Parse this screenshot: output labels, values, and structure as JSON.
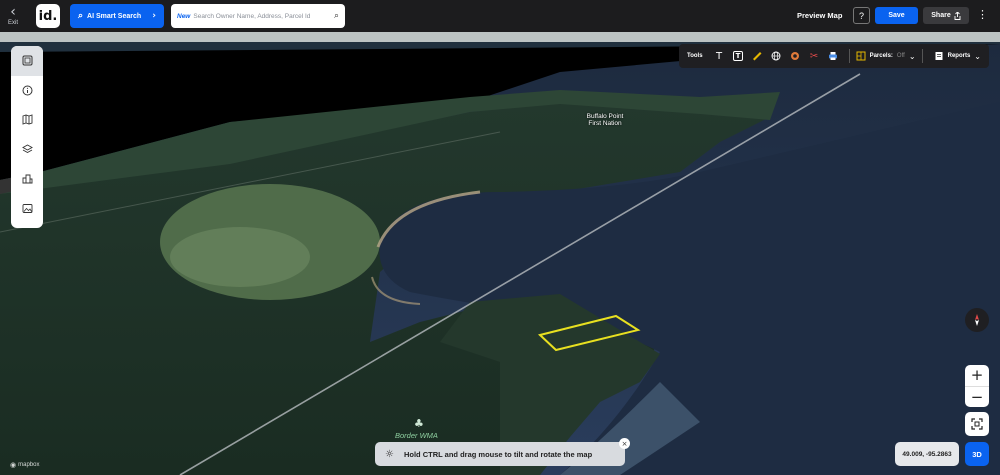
{
  "header": {
    "exit_label": "Exit",
    "logo_text": "id.",
    "ai_button_label": "AI Smart Search",
    "search_new_badge": "New",
    "search_placeholder": "Search Owner Name, Address, Parcel Id",
    "preview_label": "Preview Map",
    "help_label": "?",
    "save_label": "Save",
    "share_label": "Share"
  },
  "left_toolbar": {
    "items": [
      "panel-icon",
      "info-icon",
      "map-icon",
      "layers-icon",
      "buildings-icon",
      "image-icon"
    ]
  },
  "toolsbar": {
    "label": "Tools",
    "tools": [
      "text-icon",
      "text-box-icon",
      "ruler-icon",
      "globe-icon",
      "circle-icon",
      "scissors-icon",
      "print-icon"
    ],
    "parcels_label": "Parcels:",
    "parcels_state": "Off",
    "reports_label": "Reports"
  },
  "map": {
    "place_label": "Buffalo Point\nFirst Nation",
    "area_label": "Border WMA",
    "attribution": "mapbox",
    "coordinates": "49.009, -95.2863",
    "mode_label": "3D",
    "hint_text": "Hold CTRL and drag mouse to tilt and rotate the map"
  },
  "colors": {
    "accent": "#0a63f0",
    "parcel_outline": "#e8e020"
  }
}
